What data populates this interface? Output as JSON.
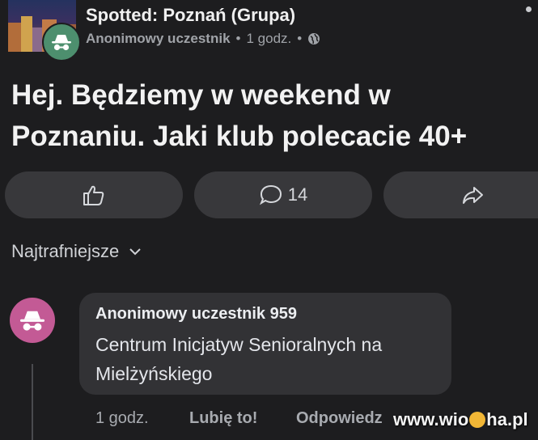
{
  "header": {
    "group_name": "Spotted: Poznań (Grupa)",
    "author": "Anonimowy uczestnik",
    "separator": "•",
    "time": "1 godz.",
    "privacy_icon": "globe-icon",
    "avatar_icon": "anonymous-incognito-icon"
  },
  "post": {
    "text": "Hej. Będziemy w weekend w Poznaniu. Jaki klub polecacie 40+"
  },
  "actions": {
    "like_icon": "thumbs-up-icon",
    "comment_icon": "comment-bubble-icon",
    "comment_count": "14",
    "share_icon": "share-arrow-icon"
  },
  "sort": {
    "label": "Najtrafniejsze",
    "icon": "chevron-down-icon"
  },
  "comments": [
    {
      "author": "Anonimowy uczestnik 959",
      "text": "Centrum Inicjatyw Senioralnych na Mielżyńskiego",
      "time": "1 godz.",
      "like_label": "Lubię to!",
      "reply_label": "Odpowiedz",
      "avatar_icon": "anonymous-incognito-icon"
    }
  ],
  "watermark": {
    "text_before": "www.wio",
    "text_after": "ha.pl"
  },
  "colors": {
    "background": "#1d1d1f",
    "pill": "#38383b",
    "bubble": "#323235",
    "anon_green": "#4d8f6e",
    "anon_pink": "#c35a95"
  }
}
